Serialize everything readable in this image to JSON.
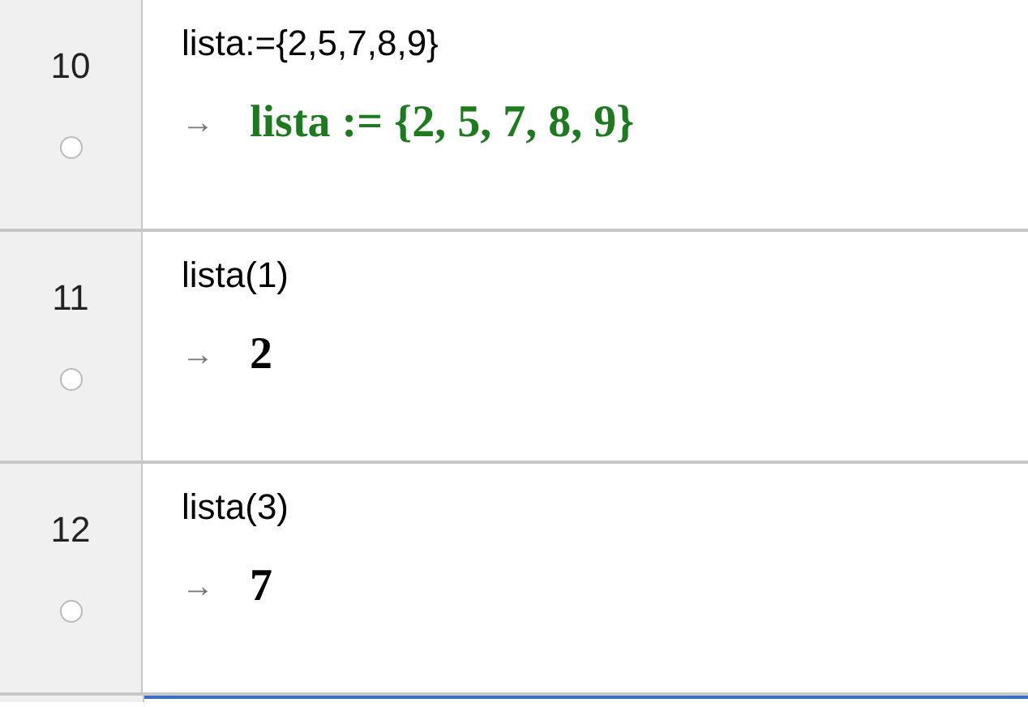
{
  "rows": [
    {
      "number": "10",
      "visible": false,
      "input": "lista:={2,5,7,8,9}",
      "arrow": "→",
      "output": "lista := {2, 5, 7, 8, 9}",
      "kind": "definition"
    },
    {
      "number": "11",
      "visible": false,
      "input": "lista(1)",
      "arrow": "→",
      "output": "2",
      "kind": "value"
    },
    {
      "number": "12",
      "visible": false,
      "input": "lista(3)",
      "arrow": "→",
      "output": "7",
      "kind": "value"
    }
  ]
}
